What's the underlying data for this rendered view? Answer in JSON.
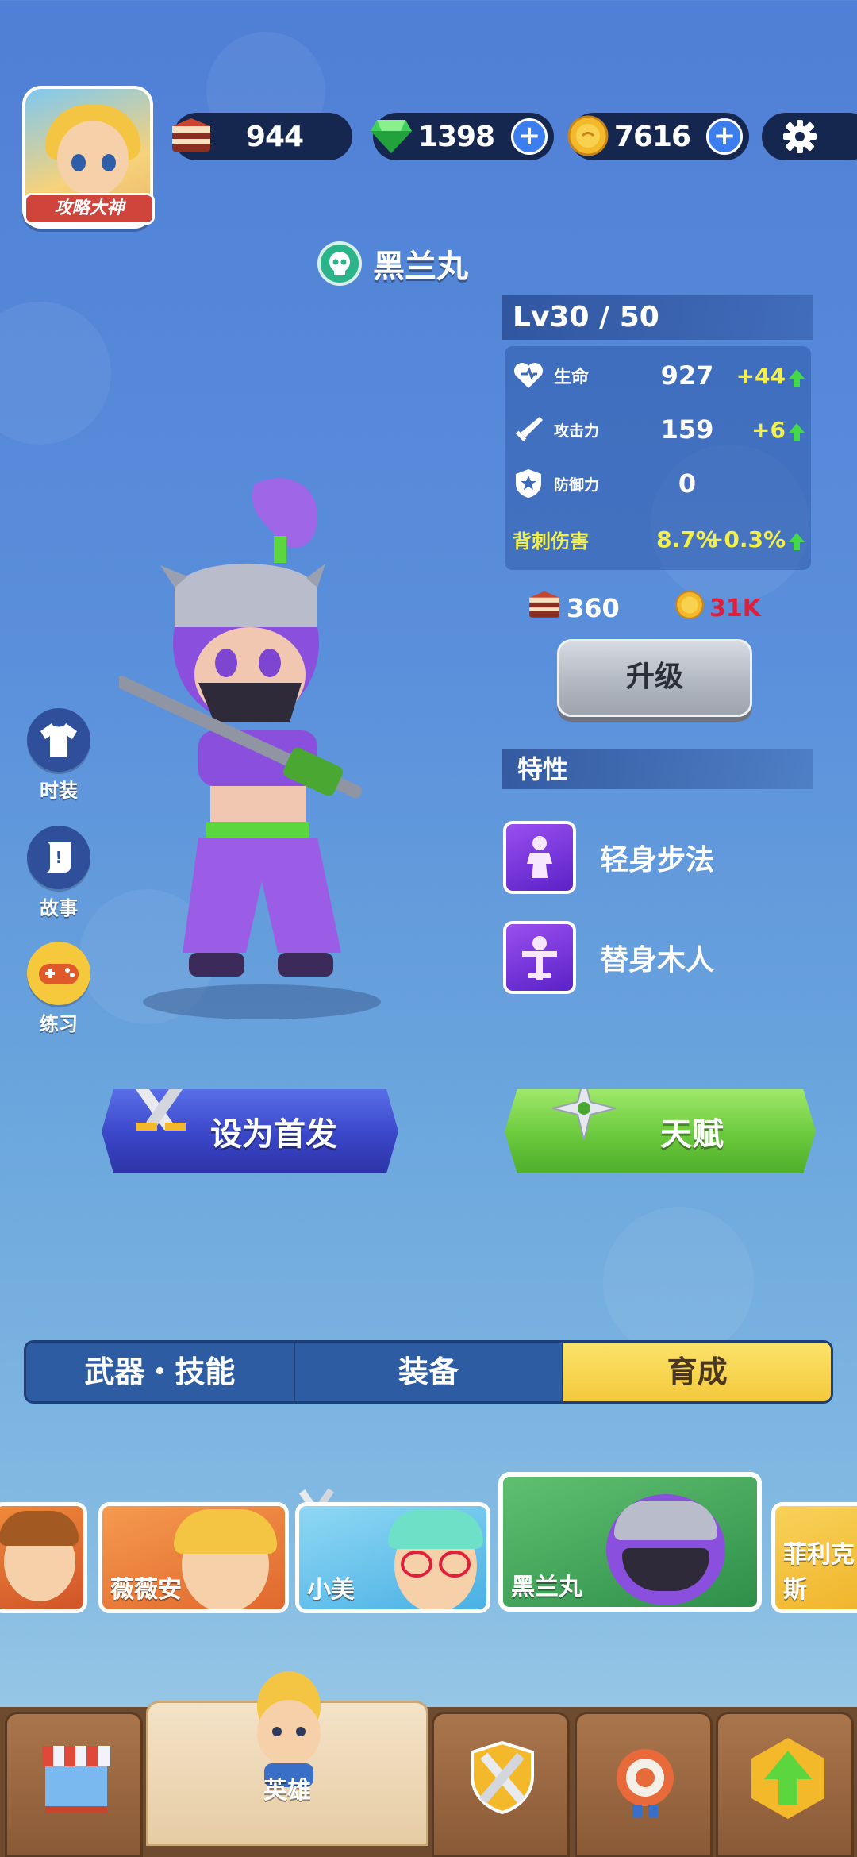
{
  "top_bar": {
    "avatar_tag": "攻略大神",
    "cake_count": "944",
    "gem_count": "1398",
    "coin_count": "7616"
  },
  "hero": {
    "name": "黑兰丸",
    "level": "Lv30 / 50"
  },
  "stats": [
    {
      "icon": "heart-icon",
      "label": "生命",
      "value": "927",
      "bonus": "+44"
    },
    {
      "icon": "sword-icon",
      "label": "攻击力",
      "value": "159",
      "bonus": "+6"
    },
    {
      "icon": "shield-icon",
      "label": "防御力",
      "value": "0",
      "bonus": ""
    },
    {
      "icon": "",
      "label": "背刺伤害",
      "value": "8.7%",
      "bonus": "+0.3%"
    }
  ],
  "upgrade": {
    "cake_cost": "360",
    "coin_cost": "31K",
    "button_label": "升级"
  },
  "traits": {
    "title": "特性",
    "items": [
      "轻身步法",
      "替身木人"
    ]
  },
  "side_buttons": [
    "时装",
    "故事",
    "练习"
  ],
  "actions": {
    "set_starter": "设为首发",
    "talent": "天赋"
  },
  "tabs": {
    "items": [
      "武器・技能",
      "装备",
      "育成"
    ],
    "active_index": 2
  },
  "carousel": {
    "cards": [
      "",
      "薇薇安",
      "小美",
      "黑兰丸",
      "菲利克斯"
    ],
    "selected_index": 3
  },
  "bottom_nav": {
    "active_label": "英雄"
  },
  "colors": {
    "bonus_yellow": "#f4f04a",
    "up_green": "#43d94a",
    "coin_cost_red": "#e0203a",
    "active_tab": "#f4c93c"
  }
}
